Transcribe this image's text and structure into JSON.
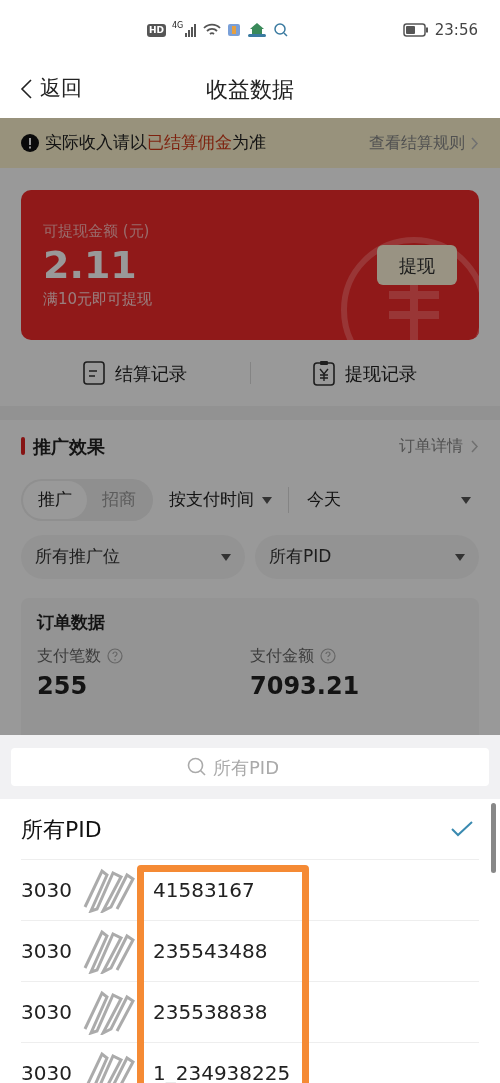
{
  "status_bar": {
    "network_labels": [
      "HD",
      "4G"
    ],
    "time": "23:56"
  },
  "nav": {
    "back": "返回",
    "title": "收益数据"
  },
  "notice": {
    "parts": [
      {
        "text": "实际收入请以",
        "highlight": false
      },
      {
        "text": "已结算佣金",
        "highlight": true
      },
      {
        "text": "为准",
        "highlight": false
      }
    ],
    "link": "查看结算规则"
  },
  "balance_card": {
    "label": "可提现金额 (元)",
    "amount": "2.11",
    "hint": "满10元即可提现",
    "button": "提现"
  },
  "records": [
    {
      "kind": "settlement",
      "label": "结算记录"
    },
    {
      "kind": "withdraw",
      "label": "提现记录"
    }
  ],
  "promotion": {
    "title": "推广效果",
    "link": "订单详情",
    "toggle": [
      {
        "label": "推广",
        "selected": true
      },
      {
        "label": "招商",
        "selected": false
      }
    ],
    "filters": [
      {
        "label": "按支付时间"
      },
      {
        "label": "今天"
      },
      {
        "label": "所有推广位"
      },
      {
        "label": "所有PID"
      }
    ],
    "orders": {
      "title": "订单数据",
      "metrics": [
        {
          "label": "支付笔数",
          "value": "255"
        },
        {
          "label": "支付金额",
          "value": "7093.21"
        }
      ]
    }
  },
  "pid_sheet": {
    "search_placeholder": "所有PID",
    "options": [
      {
        "label": "所有PID",
        "selected": true
      },
      {
        "prefix": "3030",
        "suffix": "41583167",
        "selected": false
      },
      {
        "prefix": "3030",
        "suffix": "235543488",
        "selected": false
      },
      {
        "prefix": "3030",
        "suffix": "235538838",
        "selected": false
      },
      {
        "prefix": "3030",
        "suffix": "1_234938225",
        "selected": false
      }
    ]
  }
}
